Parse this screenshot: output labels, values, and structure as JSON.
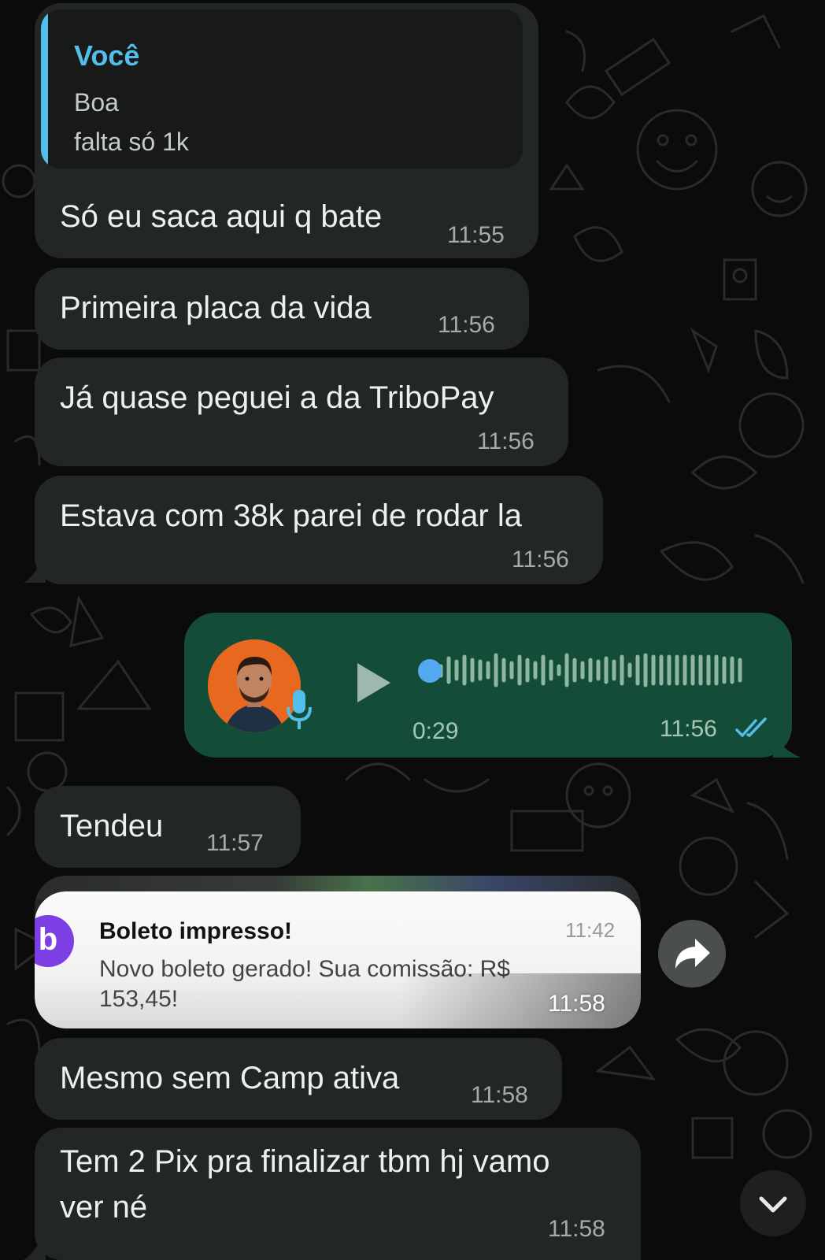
{
  "theme": {
    "incoming_bubble": "#232626",
    "outgoing_bubble": "#144d37",
    "quote_accent": "#53bdeb",
    "read_ticks": "#53bdeb"
  },
  "messages": [
    {
      "quote": {
        "author": "Você",
        "lines": [
          "Boa",
          "falta só 1k"
        ]
      },
      "text": "Só eu saca aqui q bate",
      "time": "11:55"
    },
    {
      "text": "Primeira placa da vida",
      "time": "11:56"
    },
    {
      "text": "Já quase peguei a da TriboPay",
      "time": "11:56"
    },
    {
      "text": "Estava com 38k parei de rodar la",
      "time": "11:56"
    }
  ],
  "voice_note": {
    "duration": "0:29",
    "time": "11:56",
    "status_icon": "double-check-icon"
  },
  "messages2": [
    {
      "text": "Tendeu",
      "time": "11:57"
    }
  ],
  "notification_image": {
    "app_icon_letter": "b",
    "title": "Boleto impresso!",
    "small_time": "11:42",
    "body": "Novo boleto gerado! Sua comissão: R$ 153,45!",
    "message_time": "11:58"
  },
  "messages3": [
    {
      "text": "Mesmo sem Camp ativa",
      "time": "11:58"
    },
    {
      "text_line1": "Tem 2 Pix pra finalizar tbm hj vamo",
      "text_line2": "ver né",
      "time": "11:58"
    }
  ],
  "controls": {
    "forward_icon": "forward-arrow-icon",
    "scroll_down_icon": "chevron-down-icon"
  }
}
